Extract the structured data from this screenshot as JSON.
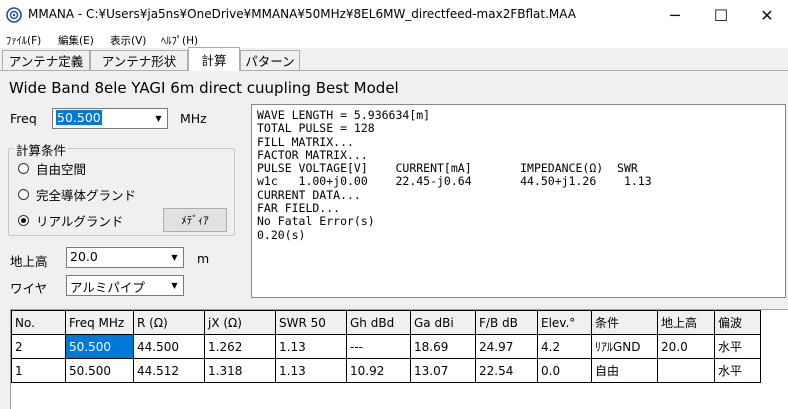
{
  "window": {
    "title": "MMANA - C:¥Users¥ja5ns¥OneDrive¥MMANA¥50MHz¥8EL6MW_directfeed-max2FBflat.MAA",
    "minimize": "─",
    "maximize": "☐",
    "close": "✕"
  },
  "menu": [
    "ﾌｧｲﾙ(F)",
    "編集(E)",
    "表示(V)",
    "ﾍﾙﾌﾟ(H)"
  ],
  "tabs": [
    "アンテナ定義",
    "アンテナ形状",
    "計算",
    "パターン"
  ],
  "active_tab": "計算",
  "model_title": "Wide Band 8ele YAGI 6m direct cuupling Best Model",
  "freq": {
    "label": "Freq",
    "value": "50.500",
    "unit": "MHz"
  },
  "conditions": {
    "legend": "計算条件",
    "options": [
      "自由空間",
      "完全導体グランド",
      "リアルグランド"
    ],
    "selected": "リアルグランド",
    "media_button": "ﾒﾃﾞｨｱ"
  },
  "height": {
    "label": "地上高",
    "value": "20.0",
    "unit": "m"
  },
  "wire": {
    "label": "ワイヤ",
    "value": "アルミパイプ"
  },
  "output_lines": [
    "WAVE LENGTH = 5.936634[m]",
    "TOTAL PULSE = 128",
    "FILL MATRIX...",
    "FACTOR MATRIX...",
    "PULSE VOLTAGE[V]    CURRENT[mA]       IMPEDANCE(Ω)  SWR",
    "w1c   1.00+j0.00    22.45-j0.64       44.50+j1.26    1.13",
    "CURRENT DATA...",
    "FAR FIELD...",
    "No Fatal Error(s)",
    "0.20(s)"
  ],
  "results_table": {
    "columns": [
      "No.",
      "Freq MHz",
      "R (Ω)",
      "jX (Ω)",
      "SWR 50",
      "Gh dBd",
      "Ga dBi",
      "F/B dB",
      "Elev.°",
      "条件",
      "地上高",
      "偏波"
    ],
    "rows": [
      [
        "2",
        "50.500",
        "44.500",
        "1.262",
        "1.13",
        "---",
        "18.69",
        "24.97",
        "4.2",
        "ﾘｱﾙGND",
        "20.0",
        "水平"
      ],
      [
        "1",
        "50.500",
        "44.512",
        "1.318",
        "1.13",
        "10.92",
        "13.07",
        "22.54",
        "0.0",
        "自由",
        "",
        "水平"
      ]
    ]
  }
}
